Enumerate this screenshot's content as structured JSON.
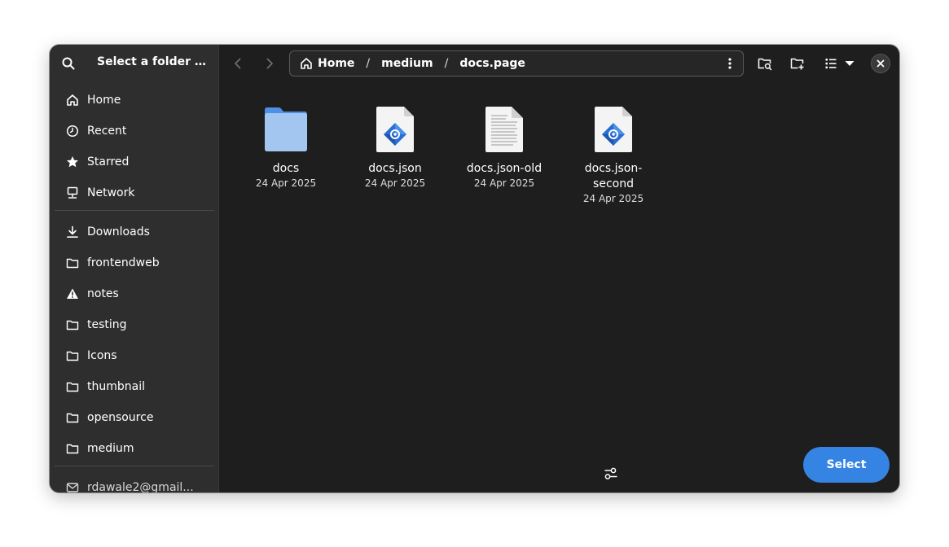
{
  "dialog": {
    "title": "Select a folder th…"
  },
  "sidebar": {
    "places": [
      {
        "label": "Home",
        "icon": "home-icon"
      },
      {
        "label": "Recent",
        "icon": "clock-icon"
      },
      {
        "label": "Starred",
        "icon": "star-icon"
      },
      {
        "label": "Network",
        "icon": "network-icon"
      }
    ],
    "bookmarks": [
      {
        "label": "Downloads",
        "icon": "download-icon"
      },
      {
        "label": "frontendweb",
        "icon": "folder-icon"
      },
      {
        "label": "notes",
        "icon": "warning-icon"
      },
      {
        "label": "testing",
        "icon": "folder-icon"
      },
      {
        "label": "Icons",
        "icon": "folder-icon"
      },
      {
        "label": "thumbnail",
        "icon": "folder-icon"
      },
      {
        "label": "opensource",
        "icon": "folder-icon"
      },
      {
        "label": "medium",
        "icon": "folder-icon"
      }
    ],
    "account": {
      "label": "rdawale2@gmail...",
      "icon": "mail-icon"
    }
  },
  "pathbar": {
    "crumbs": [
      "Home",
      "medium",
      "docs.page"
    ],
    "separator": "/"
  },
  "files": [
    {
      "name": "docs",
      "date": "24 Apr 2025",
      "type": "folder"
    },
    {
      "name": "docs.json",
      "date": "24 Apr 2025",
      "type": "json"
    },
    {
      "name": "docs.json-old",
      "date": "24 Apr 2025",
      "type": "text"
    },
    {
      "name": "docs.json-\nsecond",
      "name_line1": "docs.json-",
      "name_line2": "second",
      "date": "24 Apr 2025",
      "type": "json"
    }
  ],
  "actions": {
    "select_label": "Select"
  },
  "colors": {
    "accent": "#3584e4",
    "folder": "#a3c6f0",
    "folder_tab": "#4f8fe6",
    "window_bg": "#1e1e1e",
    "sidebar_bg": "#2e2e2e"
  }
}
